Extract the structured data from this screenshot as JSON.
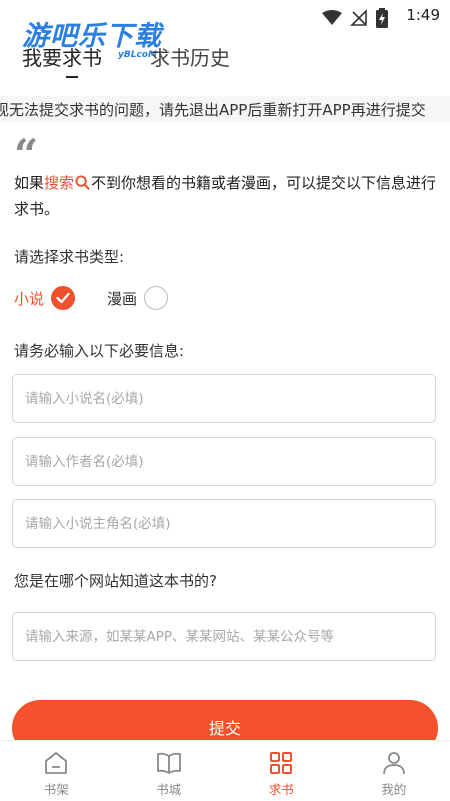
{
  "status_bar": {
    "time": "1:49"
  },
  "watermark": {
    "title": "游吧乐下载",
    "sub": "yBLcoM"
  },
  "header": {
    "tabs": [
      {
        "label": "我要求书"
      },
      {
        "label": "求书历史"
      }
    ]
  },
  "notice": "现无法提交求书的问题，请先退出APP后重新打开APP再进行提交",
  "intro": {
    "prefix": "如果",
    "highlight": "搜索",
    "suffix": "不到你想看的书籍或者漫画，可以提交以下信息进行求书。"
  },
  "type_section": {
    "label": "请选择求书类型:",
    "options": [
      {
        "label": "小说",
        "selected": true
      },
      {
        "label": "漫画",
        "selected": false
      }
    ]
  },
  "required_section": {
    "label": "请务必输入以下必要信息:",
    "fields": [
      {
        "placeholder": "请输入小说名(必填)",
        "value": ""
      },
      {
        "placeholder": "请输入作者名(必填)",
        "value": ""
      },
      {
        "placeholder": "请输入小说主角名(必填)",
        "value": ""
      }
    ]
  },
  "source_section": {
    "label": "您是在哪个网站知道这本书的?",
    "placeholder": "请输入来源，如某某APP、某某网站、某某公众号等",
    "value": ""
  },
  "submit_label": "提交",
  "bottom_nav": {
    "items": [
      {
        "label": "书架",
        "icon": "home-icon",
        "active": false
      },
      {
        "label": "书城",
        "icon": "book-icon",
        "active": false
      },
      {
        "label": "求书",
        "icon": "grid-icon",
        "active": true
      },
      {
        "label": "我的",
        "icon": "user-icon",
        "active": false
      }
    ]
  },
  "colors": {
    "accent": "#f0512c",
    "watermark": "#2a7fe0"
  }
}
